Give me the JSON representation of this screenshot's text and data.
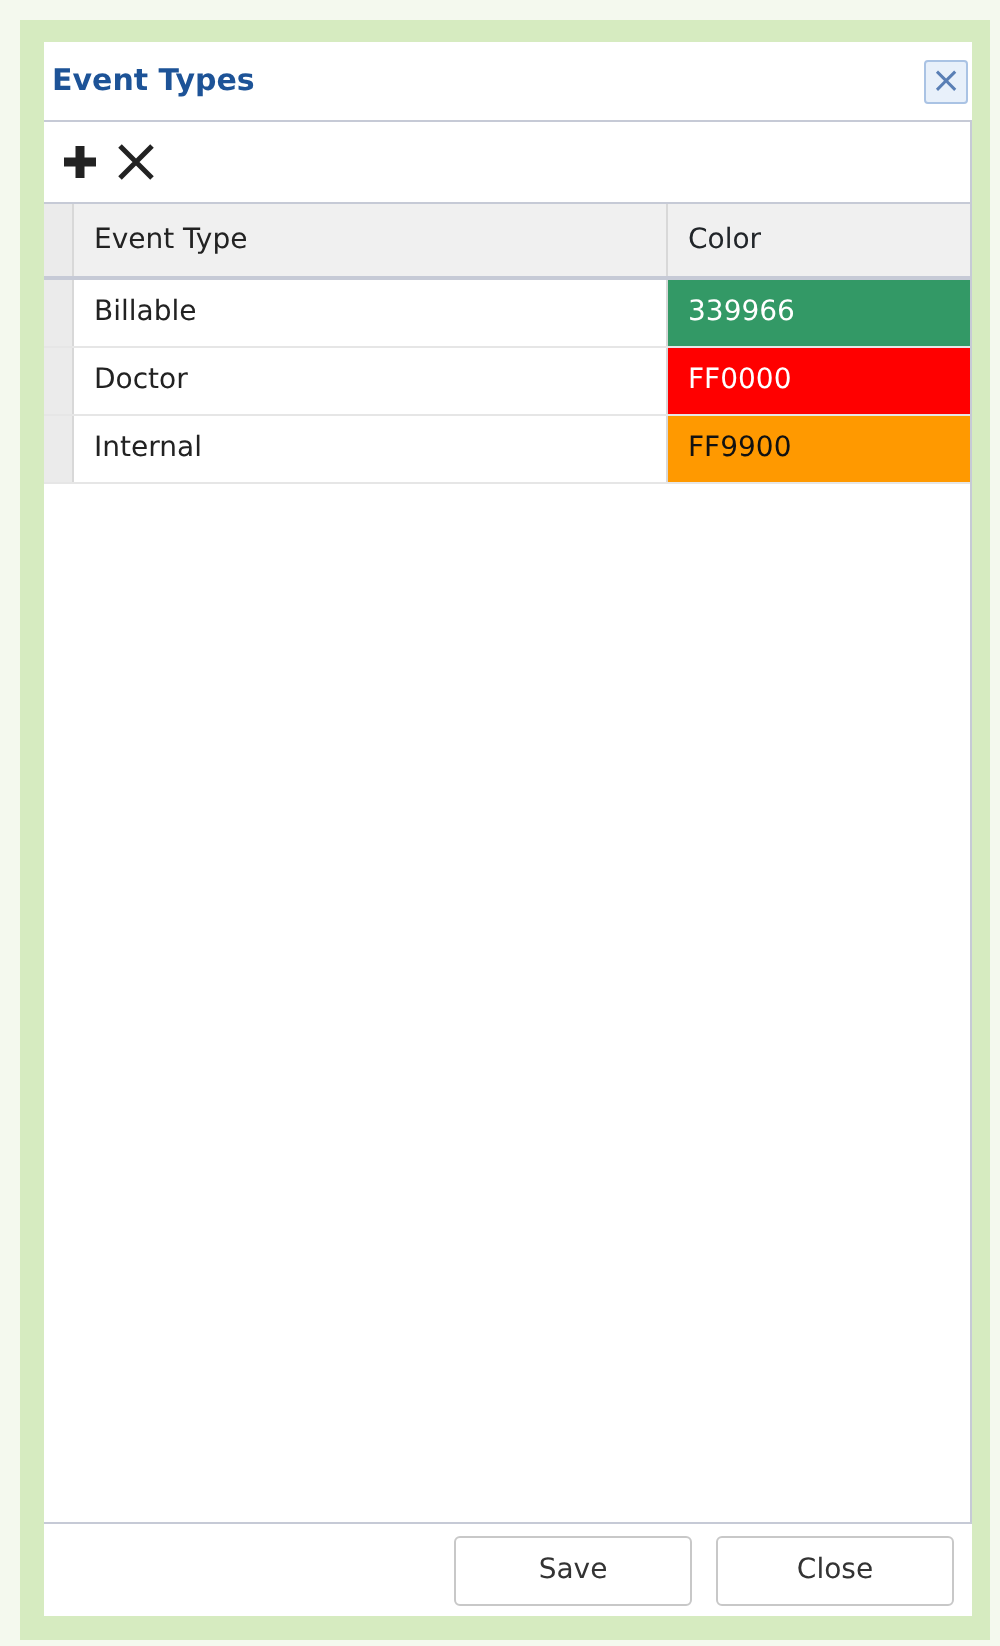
{
  "window": {
    "title": "Event Types",
    "close": "×"
  },
  "toolbar": [
    {
      "kind": "add"
    },
    {
      "kind": "delete"
    }
  ],
  "table": {
    "columns": [
      "Event Type",
      "Color"
    ],
    "rows": [
      {
        "event_type": "Billable",
        "color_code": "339966",
        "color": "#339966"
      },
      {
        "event_type": "Doctor",
        "color_code": "FF0000",
        "color": "#ff0000"
      },
      {
        "event_type": "Internal",
        "color_code": "FF9900",
        "color": "#ff9900"
      }
    ]
  },
  "buttons": [
    "Save",
    "Close"
  ]
}
